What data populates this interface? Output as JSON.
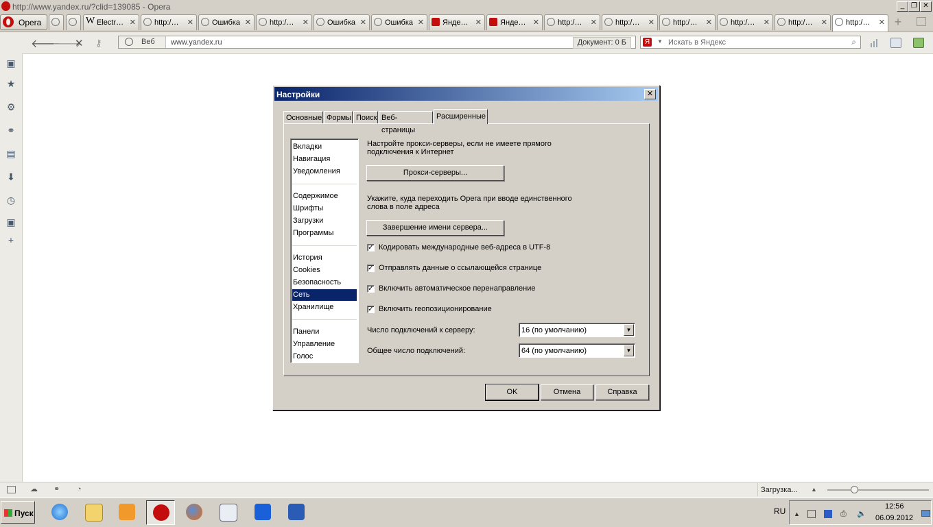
{
  "window": {
    "title": "http://www.yandex.ru/?clid=139085 - Opera",
    "minimize": "_",
    "maximize": "❐",
    "close": "✕"
  },
  "opera_menu": {
    "label": "Opera"
  },
  "tabs": [
    {
      "label": "",
      "icon": "loading-icon"
    },
    {
      "label": "",
      "icon": "loading-icon"
    },
    {
      "label": "Electr…",
      "icon": "wikipedia-icon"
    },
    {
      "label": "http:/…",
      "icon": "loading-icon"
    },
    {
      "label": "Ошибка",
      "icon": "loading-icon"
    },
    {
      "label": "http:/…",
      "icon": "loading-icon"
    },
    {
      "label": "Ошибка",
      "icon": "loading-icon"
    },
    {
      "label": "Ошибка",
      "icon": "loading-icon"
    },
    {
      "label": "Яндe…",
      "icon": "yandex-icon"
    },
    {
      "label": "Яндe…",
      "icon": "yandex-icon"
    },
    {
      "label": "http:/…",
      "icon": "loading-icon"
    },
    {
      "label": "http:/…",
      "icon": "loading-icon"
    },
    {
      "label": "http:/…",
      "icon": "loading-icon"
    },
    {
      "label": "http:/…",
      "icon": "loading-icon"
    },
    {
      "label": "http:/…",
      "icon": "loading-icon"
    },
    {
      "label": "http:/…",
      "icon": "loading-icon",
      "active": true
    }
  ],
  "tab_close": "✕",
  "address": {
    "web_label": "Веб",
    "url": "www.yandex.ru",
    "document_info": "Документ:   0 Б"
  },
  "search": {
    "engine_badge": "Я",
    "placeholder": "Искать в Яндекс"
  },
  "dialog": {
    "title": "Настройки",
    "tabs": [
      "Основные",
      "Формы",
      "Поиск",
      "Веб-страницы",
      "Расширенные"
    ],
    "categories": [
      [
        "Вкладки",
        "Навигация",
        "Уведомления"
      ],
      [
        "Содержимое",
        "Шрифты",
        "Загрузки",
        "Программы"
      ],
      [
        "История",
        "Cookies",
        "Безопасность",
        "Сеть",
        "Хранилище"
      ],
      [
        "Панели",
        "Управление",
        "Голос"
      ]
    ],
    "selected_category": "Сеть",
    "proxy_text_1": "Настройте прокси-серверы, если не имеете прямого",
    "proxy_text_2": "подключения к Интернет",
    "proxy_button": "Прокси-серверы...",
    "server_text_1": "Укажите, куда переходить Opera при вводе единственного",
    "server_text_2": "слова в поле адреса",
    "server_button": "Завершение имени сервера...",
    "checkboxes": [
      {
        "label": "Кодировать международные веб-адреса в UTF-8",
        "checked": true
      },
      {
        "label": "Отправлять данные о ссылающейся странице",
        "checked": true
      },
      {
        "label": "Включить автоматическое перенаправление",
        "checked": true
      },
      {
        "label": "Включить геопозиционирование",
        "checked": true
      }
    ],
    "server_connections_label": "Число подключений к серверу:",
    "server_connections_value": "16 (по умолчанию)",
    "total_connections_label": "Общее число подключений:",
    "total_connections_value": "64 (по умолчанию)",
    "ok": "OK",
    "cancel": "Отмена",
    "help": "Справка"
  },
  "statusbar": {
    "loading": "Загрузка..."
  },
  "taskbar": {
    "start": "Пуск",
    "lang": "RU",
    "time": "12:56",
    "date": "06.09.2012"
  },
  "colors": {
    "dialog_title_start": "#0a246a",
    "dialog_title_end": "#a6caf0",
    "selection": "#0a246a",
    "opera_red": "#c40d0d"
  }
}
